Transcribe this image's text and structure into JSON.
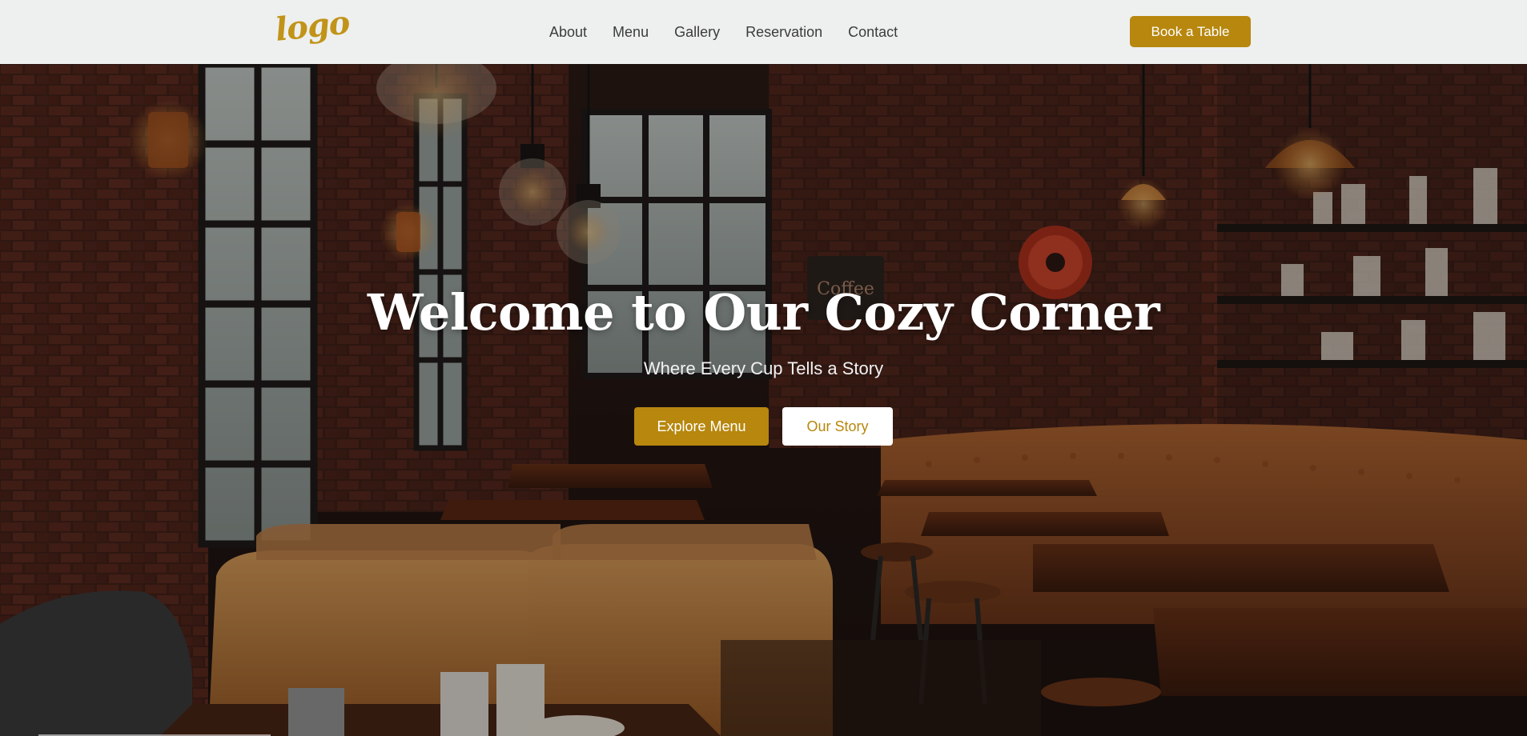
{
  "header": {
    "logo_text": "logo",
    "nav": [
      "About",
      "Menu",
      "Gallery",
      "Reservation",
      "Contact"
    ],
    "cta_label": "Book a Table"
  },
  "hero": {
    "title": "Welcome to Our Cozy Corner",
    "subtitle": "Where Every Cup Tells a Story",
    "primary_button": "Explore Menu",
    "secondary_button": "Our Story",
    "background_image": "cafe-interior-photo",
    "sign_text": "Coffee"
  },
  "colors": {
    "accent": "#b7870e",
    "header_bg": "#f6f7f7",
    "nav_text": "#3c3c3c",
    "hero_text": "#ffffff"
  }
}
